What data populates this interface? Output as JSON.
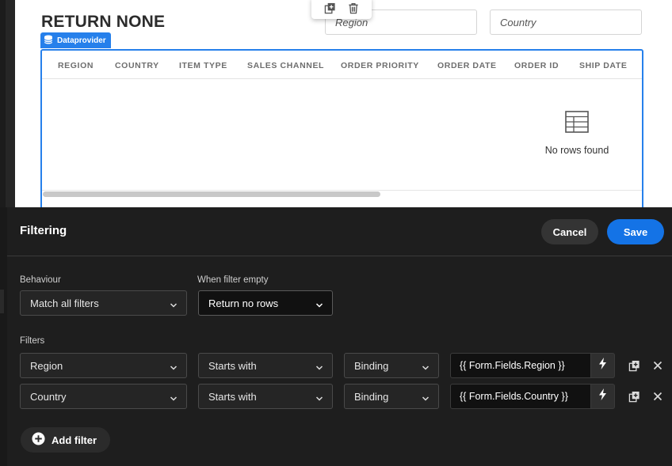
{
  "canvas": {
    "title": "RETURN NONE",
    "inputs": {
      "region_placeholder": "Region",
      "country_placeholder": "Country"
    },
    "dataprovider_tag": "Dataprovider",
    "table": {
      "columns": [
        "REGION",
        "COUNTRY",
        "ITEM TYPE",
        "SALES CHANNEL",
        "ORDER PRIORITY",
        "ORDER DATE",
        "ORDER ID",
        "SHIP DATE"
      ],
      "empty_text": "No rows found"
    }
  },
  "panel": {
    "title": "Filtering",
    "cancel_label": "Cancel",
    "save_label": "Save",
    "behaviour": {
      "label": "Behaviour",
      "value": "Match all filters"
    },
    "when_empty": {
      "label": "When filter empty",
      "value": "Return no rows"
    },
    "filters_label": "Filters",
    "filters": [
      {
        "field": "Region",
        "operator": "Starts with",
        "source": "Binding",
        "value": "{{ Form.Fields.Region }}"
      },
      {
        "field": "Country",
        "operator": "Starts with",
        "source": "Binding",
        "value": "{{ Form.Fields.Country }}"
      }
    ],
    "add_filter_label": "Add filter"
  },
  "colors": {
    "accent": "#1473e6",
    "selection": "#2680eb",
    "panel_bg": "#1e1e1e"
  },
  "icons": [
    "duplicate-icon",
    "trash-icon",
    "database-icon",
    "table-icon",
    "chevron-down-icon",
    "bolt-icon",
    "close-icon",
    "plus-circle-icon"
  ]
}
